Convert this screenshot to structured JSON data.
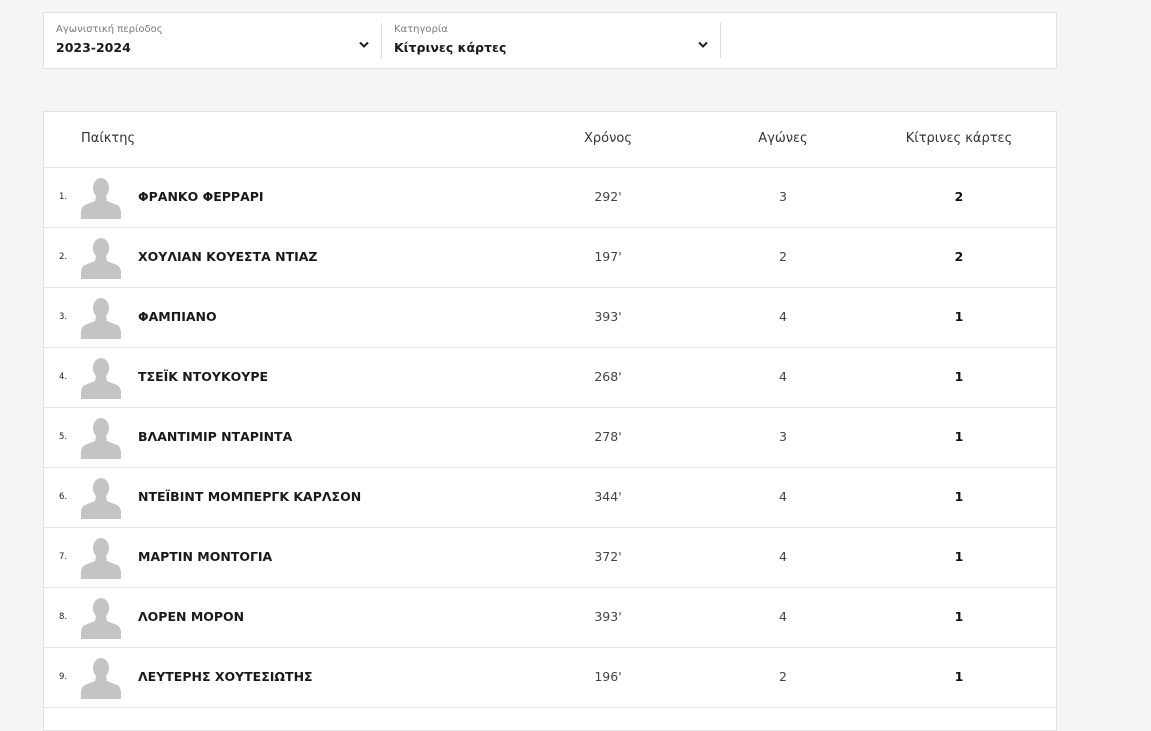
{
  "filters": {
    "season": {
      "label": "Αγωνιστική περίοδος",
      "value": "2023-2024",
      "icon": "chevron-down-icon"
    },
    "category": {
      "label": "Κατηγορία",
      "value": "Κίτρινες κάρτες",
      "icon": "chevron-down-icon"
    }
  },
  "table": {
    "headers": {
      "player": "Παίκτης",
      "time": "Χρόνος",
      "matches": "Αγώνες",
      "cards": "Κίτρινες κάρτες"
    },
    "rows": [
      {
        "rank": "1.",
        "name": "ΦΡΑΝΚΟ ΦΕΡΡΑΡΙ",
        "time": "292'",
        "matches": "3",
        "cards": "2"
      },
      {
        "rank": "2.",
        "name": "ΧΟΥΛΙΑΝ ΚΟΥΕΣΤΑ ΝΤΙΑΖ",
        "time": "197'",
        "matches": "2",
        "cards": "2"
      },
      {
        "rank": "3.",
        "name": "ΦΑΜΠΙΑΝΟ",
        "time": "393'",
        "matches": "4",
        "cards": "1"
      },
      {
        "rank": "4.",
        "name": "ΤΣΕΪΚ ΝΤΟΥΚΟΥΡΕ",
        "time": "268'",
        "matches": "4",
        "cards": "1"
      },
      {
        "rank": "5.",
        "name": "ΒΛΑΝΤΙΜΙΡ ΝΤΑΡΙΝΤΑ",
        "time": "278'",
        "matches": "3",
        "cards": "1"
      },
      {
        "rank": "6.",
        "name": "ΝΤΕΪΒΙΝΤ ΜΟΜΠΕΡΓΚ ΚΑΡΛΣΟΝ",
        "time": "344'",
        "matches": "4",
        "cards": "1"
      },
      {
        "rank": "7.",
        "name": "ΜΑΡΤΙΝ ΜΟΝΤΟΓΙΑ",
        "time": "372'",
        "matches": "4",
        "cards": "1"
      },
      {
        "rank": "8.",
        "name": "ΛΟΡΕΝ ΜΟΡΟΝ",
        "time": "393'",
        "matches": "4",
        "cards": "1"
      },
      {
        "rank": "9.",
        "name": "ΛΕΥΤΕΡΗΣ ΧΟΥΤΕΣΙΩΤΗΣ",
        "time": "196'",
        "matches": "2",
        "cards": "1"
      }
    ],
    "avatar_icon": "player-silhouette-icon"
  },
  "colors": {
    "page_background": "#f5f5f5",
    "card_background": "#ffffff",
    "border": "#e2e2e2",
    "avatar": "#c4c4c4"
  }
}
